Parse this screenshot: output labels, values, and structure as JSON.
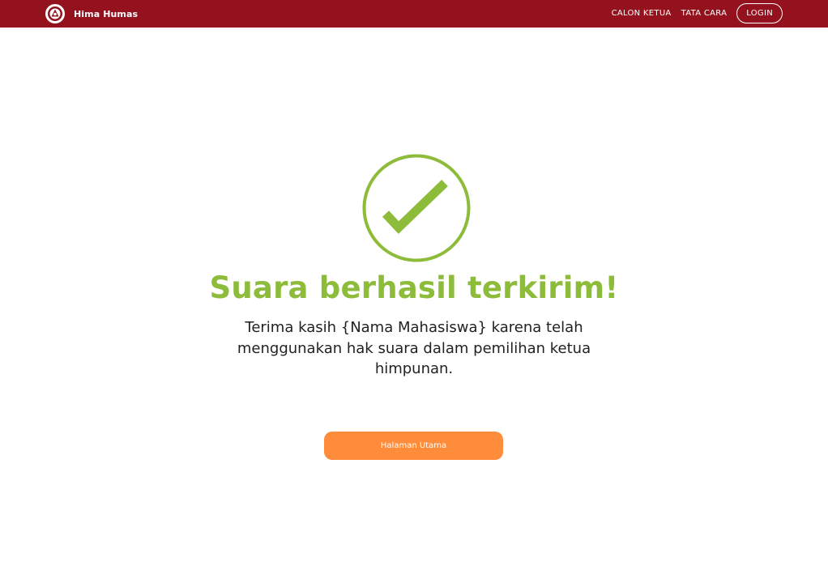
{
  "navbar": {
    "brand_name": "Hima Humas",
    "links": [
      "CALON KETUA",
      "TATA CARA"
    ],
    "login_label": "LOGIN"
  },
  "main": {
    "title": "Suara berhasil terkirim!",
    "message": "Terima kasih {Nama Mahasiswa} karena telah menggunakan hak suara dalam pemilihan ketua himpunan.",
    "home_button_label": "Halaman Utama"
  },
  "icons": {
    "logo": "organization-logo-icon",
    "success": "checkmark-circle-icon"
  },
  "colors": {
    "navbar": "#93121d",
    "success": "#8dbb3a",
    "button": "#ff8c3a"
  }
}
